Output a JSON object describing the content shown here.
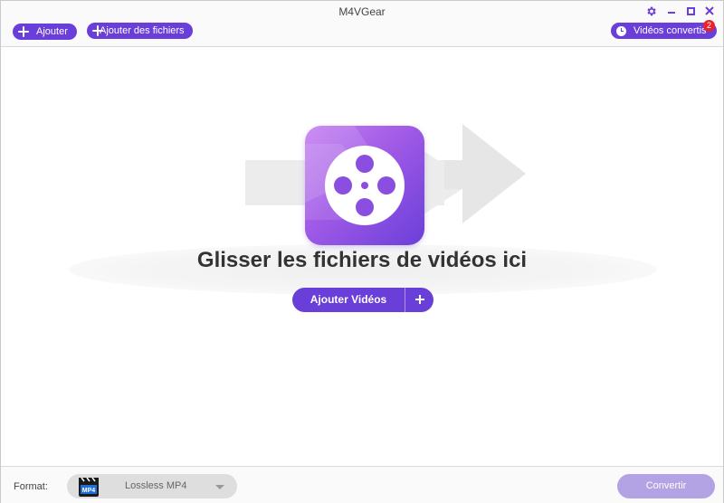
{
  "app": {
    "title": "M4VGear"
  },
  "toolbar": {
    "add_label": "Ajouter",
    "add_files_label": "Ajouter des fichiers",
    "converted_label": "Vidéos convertis",
    "converted_badge": "2"
  },
  "window_controls": {
    "settings_icon": "gear-icon",
    "minimize_icon": "minimize-icon",
    "maximize_icon": "maximize-icon",
    "close_icon": "close-icon"
  },
  "dropzone": {
    "title": "Glisser les fichiers de vidéos ici",
    "add_videos_label": "Ajouter Vidéos",
    "icon": "film-reel-icon"
  },
  "bottombar": {
    "format_label": "Format:",
    "format_icon_text": "MP4",
    "format_value": "Lossless MP4",
    "convert_label": "Convertir"
  },
  "colors": {
    "accent": "#6a3fd9",
    "badge": "#e8232a",
    "convert_disabled": "#b4a3e4"
  }
}
